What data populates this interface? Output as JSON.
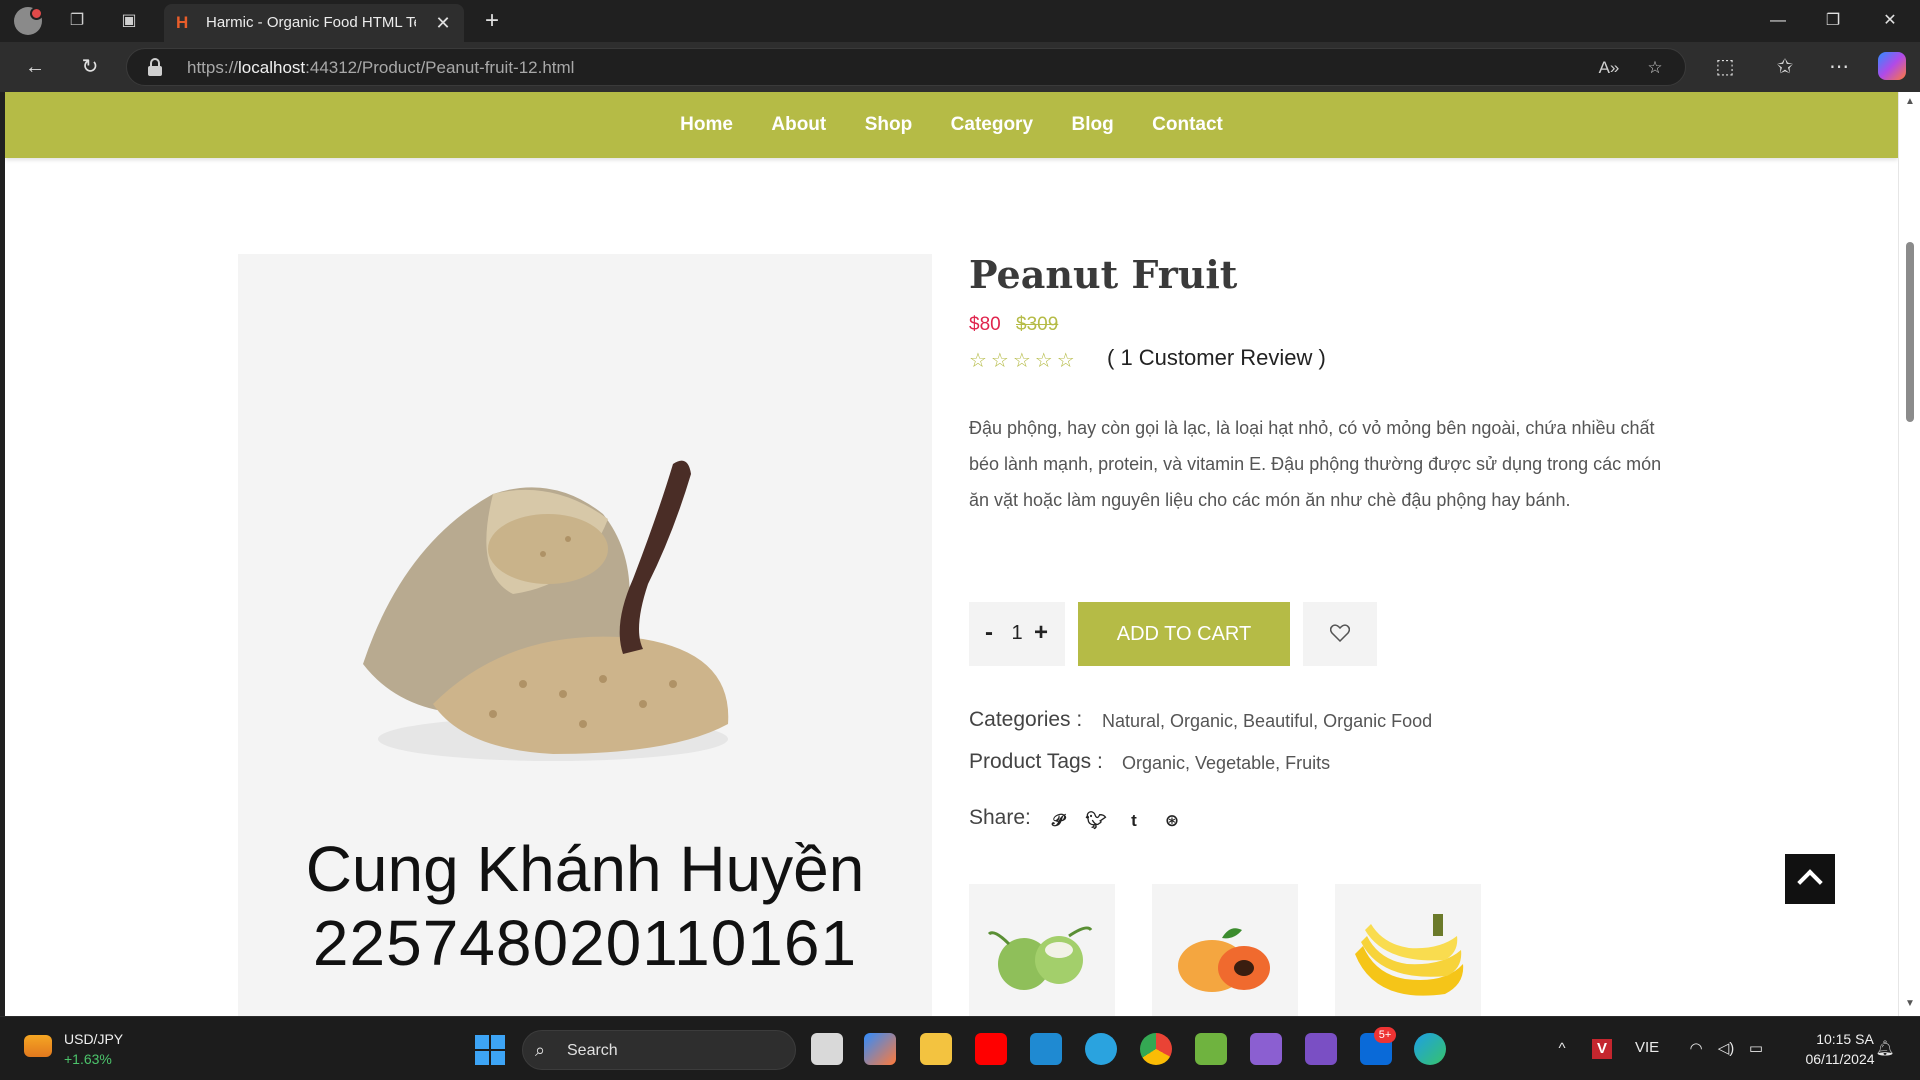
{
  "browser": {
    "tab_title": "Harmic - Organic Food HTML Ten",
    "url_scheme": "https://",
    "url_host": "localhost",
    "url_path": ":44312/Product/Peanut-fruit-12.html"
  },
  "site_nav": {
    "items": [
      {
        "label": "Home"
      },
      {
        "label": "About"
      },
      {
        "label": "Shop"
      },
      {
        "label": "Category"
      },
      {
        "label": "Blog"
      },
      {
        "label": "Contact"
      }
    ]
  },
  "product": {
    "title": "Peanut Fruit",
    "price": "$80",
    "old_price": "$309",
    "stars": "☆☆☆☆☆",
    "review_text": "( 1 Customer Review )",
    "description": "Đậu phộng, hay còn gọi là lạc, là loại hạt nhỏ, có vỏ mỏng bên ngoài, chứa nhiều chất béo lành mạnh, protein, và vitamin E. Đậu phộng thường được sử dụng trong các món ăn vặt hoặc làm nguyên liệu cho các món ăn như chè đậu phộng hay bánh.",
    "quantity": "1",
    "qty_minus": "-",
    "qty_plus": "+",
    "add_to_cart": "ADD TO CART",
    "categories_label": "Categories :",
    "categories": "Natural, Organic, Beautiful, Organic Food",
    "tags_label": "Product Tags :",
    "tags": "Organic, Vegetable, Fruits",
    "share_label": "Share:",
    "image_caption_line1": "Cung Khánh Huyền",
    "image_caption_line2": "2257480201101​61"
  },
  "taskbar": {
    "stock_name": "USD/JPY",
    "stock_change": "+1.63%",
    "search_label": "Search",
    "zalo_badge": "5+",
    "language": "VIE",
    "time": "10:15 SA",
    "date": "06/11/2024"
  },
  "colors": {
    "accent": "#b5bb46",
    "price_red": "#e0244d"
  }
}
